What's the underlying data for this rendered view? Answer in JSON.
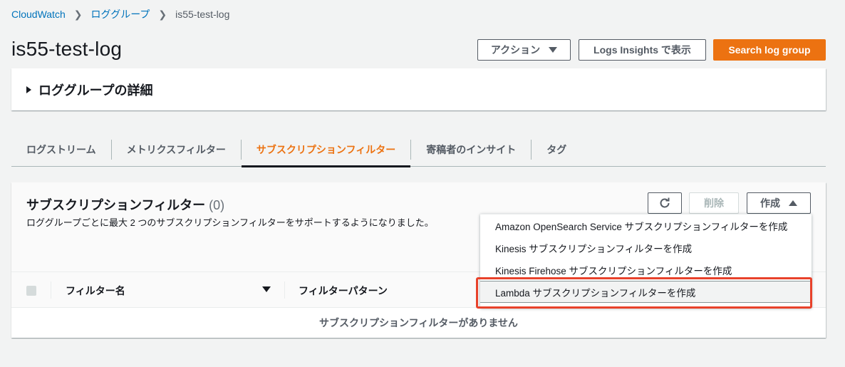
{
  "breadcrumb": {
    "root": "CloudWatch",
    "parent": "ロググループ",
    "current": "is55-test-log"
  },
  "page_title": "is55-test-log",
  "header_actions": {
    "actions_label": "アクション",
    "insights_label": "Logs Insights で表示",
    "search_label": "Search log group"
  },
  "details": {
    "title": "ロググループの詳細"
  },
  "tabs": [
    {
      "label": "ログストリーム"
    },
    {
      "label": "メトリクスフィルター"
    },
    {
      "label": "サブスクリプションフィルター"
    },
    {
      "label": "寄稿者のインサイト"
    },
    {
      "label": "タグ"
    }
  ],
  "active_tab": 2,
  "subscription": {
    "title": "サブスクリプションフィルター",
    "count": "(0)",
    "description": "ロググループごとに最大 2 つのサブスクリプションフィルターをサポートするようになりました。",
    "delete_label": "削除",
    "create_label": "作成",
    "columns": {
      "name": "フィルター名",
      "pattern": "フィルターパターン"
    },
    "empty_message": "サブスクリプションフィルターがありません"
  },
  "create_menu": [
    {
      "label": "Amazon OpenSearch Service サブスクリプションフィルターを作成"
    },
    {
      "label": "Kinesis サブスクリプションフィルターを作成"
    },
    {
      "label": "Kinesis Firehose サブスクリプションフィルターを作成"
    },
    {
      "label": "Lambda サブスクリプションフィルターを作成"
    }
  ],
  "highlight_color": "#e8422b",
  "accent_color": "#ec7211",
  "link_color": "#0073bb"
}
